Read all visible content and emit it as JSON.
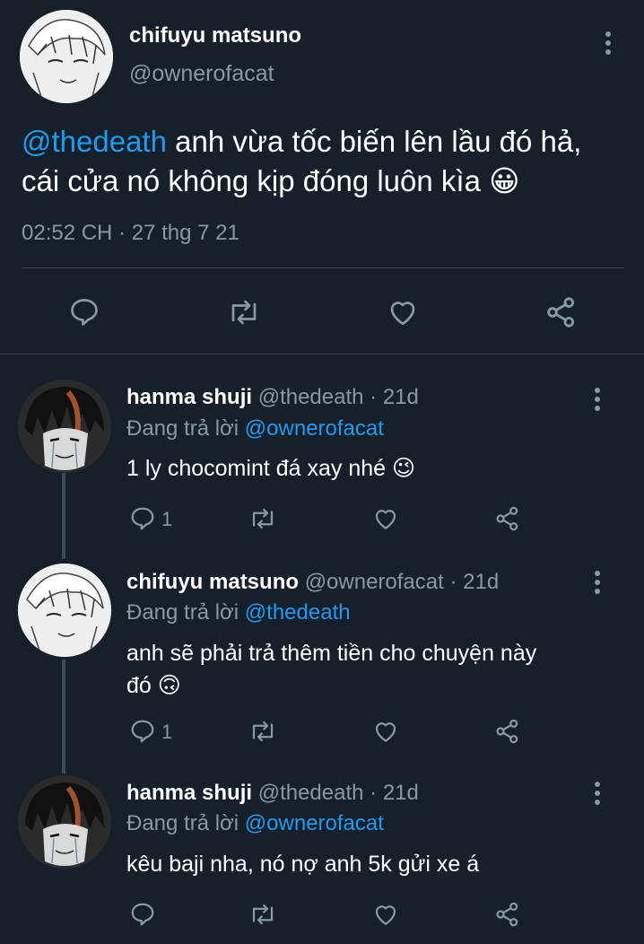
{
  "main_tweet": {
    "display_name": "chifuyu matsuno",
    "handle": "@ownerofacat",
    "mention": "@thedeath",
    "text_line1": "anh vừa tốc biến lên lầu đó hả,",
    "text_line2": "cái cửa nó không kịp đóng luôn kìa",
    "emoji": "😀",
    "timestamp": "02:52 CH · 27 thg 7 21"
  },
  "replies": [
    {
      "display_name": "hanma shuji",
      "meta": "@thedeath · 21d",
      "replying_prefix": "Đang trả lời",
      "replying_to": "@ownerofacat",
      "text": "1 ly chocomint đá xay nhé",
      "emoji": "😉",
      "reply_count": "1"
    },
    {
      "display_name": "chifuyu matsuno",
      "meta": "@ownerofacat · 21d",
      "replying_prefix": "Đang trả lời",
      "replying_to": "@thedeath",
      "text_line1": "anh sẽ phải trả thêm tiền cho chuyện này",
      "text_line2": "đó",
      "emoji": "🙃",
      "reply_count": "1"
    },
    {
      "display_name": "hanma shuji",
      "meta": "@thedeath · 21d",
      "replying_prefix": "Đang trả lời",
      "replying_to": "@ownerofacat",
      "text": "kêu baji nha, nó nợ anh 5k gửi xe á",
      "reply_count": ""
    }
  ],
  "colors": {
    "background": "#15202b",
    "accent": "#1d9bf0",
    "muted": "#8899a6",
    "divider": "#38444d"
  },
  "icons": [
    "more-icon",
    "reply-icon",
    "retweet-icon",
    "like-icon",
    "share-icon"
  ]
}
